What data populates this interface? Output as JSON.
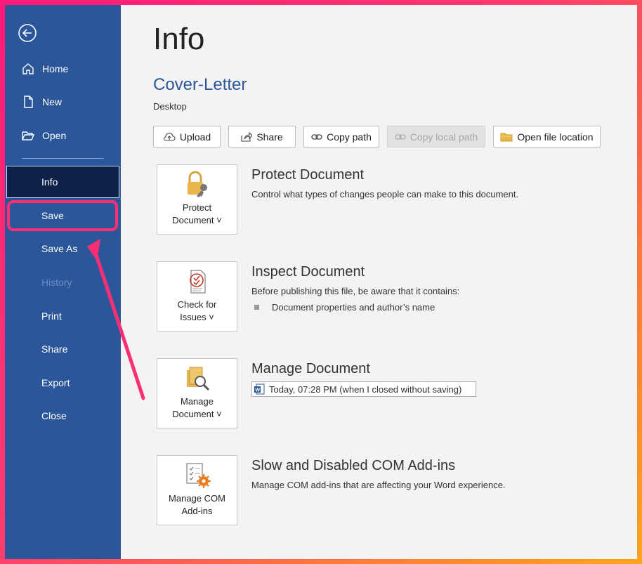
{
  "sidebar": {
    "items": [
      {
        "label": "Home"
      },
      {
        "label": "New"
      },
      {
        "label": "Open"
      },
      {
        "label": "Info"
      },
      {
        "label": "Save"
      },
      {
        "label": "Save As"
      },
      {
        "label": "History"
      },
      {
        "label": "Print"
      },
      {
        "label": "Share"
      },
      {
        "label": "Export"
      },
      {
        "label": "Close"
      }
    ]
  },
  "main": {
    "title": "Info",
    "document_name": "Cover-Letter",
    "document_location": "Desktop",
    "actions": [
      {
        "label": "Upload",
        "icon": "upload-icon"
      },
      {
        "label": "Share",
        "icon": "share-icon"
      },
      {
        "label": "Copy path",
        "icon": "link-icon"
      },
      {
        "label": "Copy local path",
        "icon": "link-icon"
      },
      {
        "label": "Open file location",
        "icon": "folder-icon"
      }
    ],
    "sections": {
      "protect": {
        "button_line1": "Protect",
        "button_line2": "Document ˅",
        "title": "Protect Document",
        "desc": "Control what types of changes people can make to this document."
      },
      "inspect": {
        "button_line1": "Check for",
        "button_line2": "Issues ˅",
        "title": "Inspect Document",
        "desc": "Before publishing this file, be aware that it contains:",
        "bullet": "Document properties and author’s name"
      },
      "manage": {
        "button_line1": "Manage",
        "button_line2": "Document ˅",
        "title": "Manage Document",
        "version": "Today, 07:28 PM (when I closed without saving)"
      },
      "addins": {
        "button_line1": "Manage COM",
        "button_line2": "Add-ins",
        "title": "Slow and Disabled COM Add-ins",
        "desc": "Manage COM add-ins that are affecting your Word experience."
      }
    }
  },
  "colors": {
    "sidebar": "#2b579a",
    "selected": "#0e2249",
    "highlight": "#ff2e74"
  }
}
